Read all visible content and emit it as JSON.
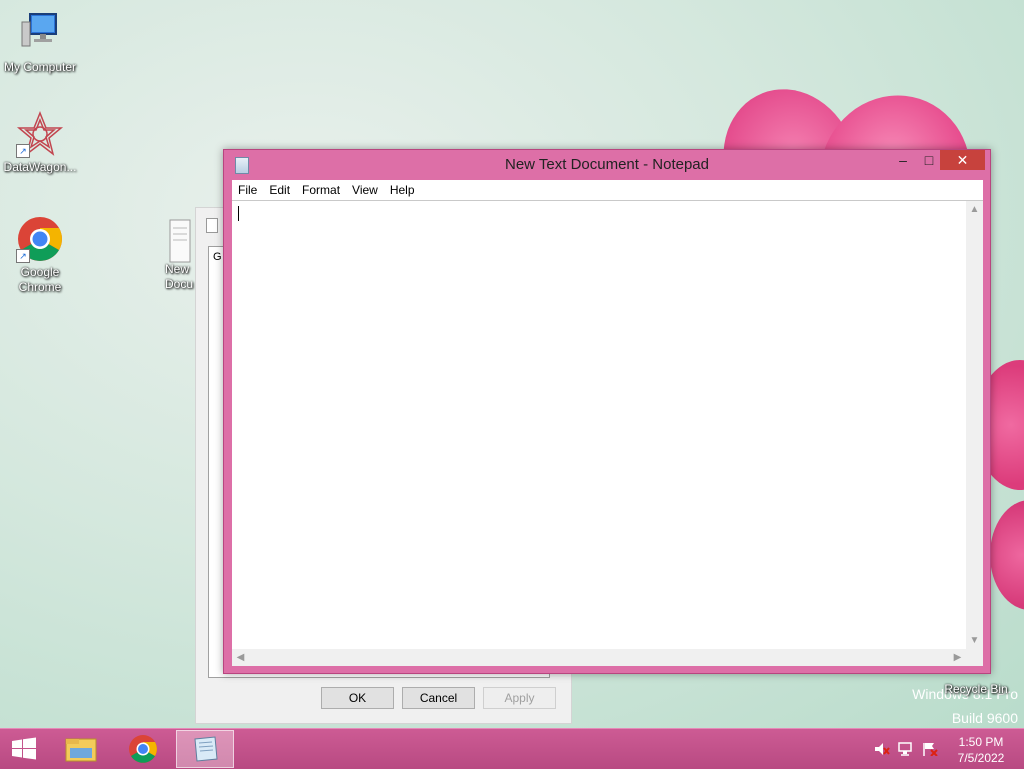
{
  "desktop": {
    "icons": [
      {
        "label": "My Computer",
        "icon": "computer-icon"
      },
      {
        "label": "DataWagon...",
        "icon": "datawagon-icon"
      },
      {
        "label": "Google Chrome",
        "icon": "chrome-icon"
      },
      {
        "label": "New Docu",
        "icon": "text-document-icon"
      }
    ],
    "watermark": {
      "line1": "Windows 8.1 Pro",
      "line2": "Build 9600"
    },
    "recycle_bin": {
      "label": "Recycle Bin",
      "icon": "recycle-bin-icon"
    }
  },
  "background_dialog": {
    "partial_text": "G",
    "buttons": {
      "ok": "OK",
      "cancel": "Cancel",
      "apply": "Apply"
    }
  },
  "notepad": {
    "title": "New Text Document - Notepad",
    "menu": [
      "File",
      "Edit",
      "Format",
      "View",
      "Help"
    ],
    "content": "",
    "caption_buttons": {
      "minimize": "‒",
      "maximize": "□",
      "close": "✕"
    }
  },
  "taskbar": {
    "items": [
      {
        "icon": "windows-start-icon"
      },
      {
        "icon": "file-explorer-icon"
      },
      {
        "icon": "chrome-icon"
      },
      {
        "icon": "notepad-icon",
        "active": true
      }
    ],
    "tray": [
      "volume-muted-icon",
      "network-icon",
      "action-center-flag-icon"
    ],
    "clock": {
      "time": "1:50 PM",
      "date": "7/5/2022"
    }
  },
  "colors": {
    "window_frame": "#dd6fa7",
    "taskbar": "#c4528b",
    "close_button": "#c7423d"
  }
}
